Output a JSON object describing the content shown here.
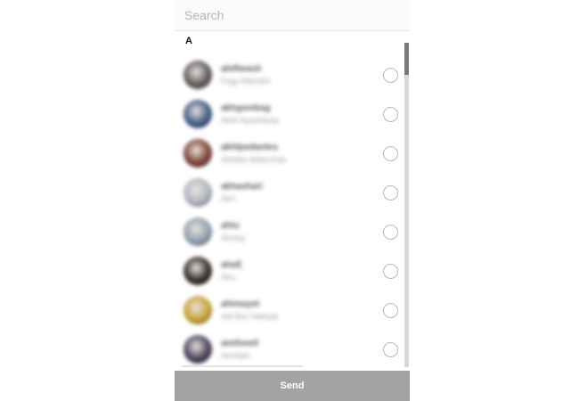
{
  "search": {
    "placeholder": "Search",
    "value": ""
  },
  "section_header": "A",
  "contacts": [
    {
      "username": "aleftwash",
      "full_name": "Fagy Aftenfeh",
      "avatar_color": "#5f5a5a",
      "selected": false
    },
    {
      "username": "akhgsmbag",
      "full_name": "Akhil Ayankbsay",
      "avatar_color": "#3f5a85",
      "selected": false
    },
    {
      "username": "akhlpedantes",
      "full_name": "Akhilep Aldanchye",
      "avatar_color": "#7a4033",
      "selected": false
    },
    {
      "username": "akhashari",
      "full_name": "Ahrl",
      "avatar_color": "#b0b6c2",
      "selected": false
    },
    {
      "username": "ahlu",
      "full_name": "Ahnlay",
      "avatar_color": "#8fa0b0",
      "selected": false
    },
    {
      "username": "ahall_",
      "full_name": "Ahu",
      "avatar_color": "#2f2b24",
      "selected": false
    },
    {
      "username": "ahimayet",
      "full_name": "Adi Bez Naleyat",
      "avatar_color": "#c9a230",
      "selected": false
    },
    {
      "username": "amilseeli",
      "full_name": "Aemlale",
      "avatar_color": "#4a3f59",
      "selected": false
    }
  ],
  "send_button": {
    "label": "Send"
  },
  "colors": {
    "send_button_bg": "#a3a3a3",
    "radio_border": "#b9b9b9",
    "search_bg": "#fafafa"
  },
  "icons": {
    "select_indicator": "radio-circle-icon"
  }
}
